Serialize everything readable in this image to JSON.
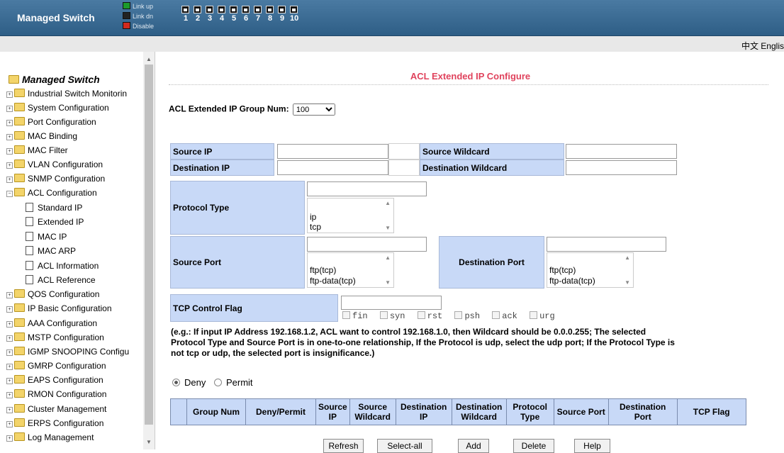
{
  "header": {
    "title": "Managed Switch",
    "legend": [
      {
        "label": "Link up",
        "color": "#1c9a2a"
      },
      {
        "label": "Link dn",
        "color": "#222222"
      },
      {
        "label": "Disable",
        "color": "#d22a1e"
      }
    ],
    "ports": [
      "1",
      "2",
      "3",
      "4",
      "5",
      "6",
      "7",
      "8",
      "9",
      "10"
    ],
    "lang": "中文  Englis"
  },
  "sidebar": {
    "root": "Managed Switch",
    "items": [
      {
        "label": "Industrial Switch Monitorin"
      },
      {
        "label": "System Configuration"
      },
      {
        "label": "Port Configuration"
      },
      {
        "label": "MAC Binding"
      },
      {
        "label": "MAC Filter"
      },
      {
        "label": "VLAN Configuration"
      },
      {
        "label": "SNMP Configuration"
      },
      {
        "label": "ACL Configuration",
        "expanded": true
      },
      {
        "label": "Standard IP",
        "child": true
      },
      {
        "label": "Extended IP",
        "child": true
      },
      {
        "label": "MAC IP",
        "child": true
      },
      {
        "label": "MAC ARP",
        "child": true
      },
      {
        "label": "ACL Information",
        "child": true
      },
      {
        "label": "ACL Reference",
        "child": true
      },
      {
        "label": "QOS Configuration"
      },
      {
        "label": "IP Basic Configuration"
      },
      {
        "label": "AAA Configuration"
      },
      {
        "label": "MSTP Configuration"
      },
      {
        "label": "IGMP SNOOPING Configu"
      },
      {
        "label": "GMRP Configuration"
      },
      {
        "label": "EAPS Configuration"
      },
      {
        "label": "RMON Configuration"
      },
      {
        "label": "Cluster Management"
      },
      {
        "label": "ERPS Configuration"
      },
      {
        "label": "Log Management"
      }
    ]
  },
  "main": {
    "title": "ACL Extended IP Configure",
    "group_label": "ACL Extended IP Group Num:",
    "group_value": "100",
    "source_ip": "Source IP",
    "source_wildcard": "Source Wildcard",
    "destination_ip": "Destination IP",
    "destination_wildcard": "Destination Wildcard",
    "protocol_type": "Protocol Type",
    "protocol_options": [
      "ip",
      "tcp"
    ],
    "source_port": "Source Port",
    "destination_port": "Destination Port",
    "port_options": [
      "ftp(tcp)",
      "ftp-data(tcp)"
    ],
    "tcp_flag": "TCP Control Flag",
    "flags": [
      "fin",
      "syn",
      "rst",
      "psh",
      "ack",
      "urg"
    ],
    "note": "(e.g.: If input IP Address 192.168.1.2, ACL want to control 192.168.1.0, then Wildcard should be 0.0.0.255; The selected Protocol Type and Source Port is in one-to-one relationship, If the Protocol is udp, select the udp port; If the Protocol Type is not tcp or udp, the selected port is insignificance.)",
    "deny": "Deny",
    "permit": "Permit",
    "table_headers": [
      "",
      "Group Num",
      "Deny/Permit",
      "Source IP",
      "Source Wildcard",
      "Destination IP",
      "Destination Wildcard",
      "Protocol Type",
      "Source Port",
      "Destination Port",
      "TCP Flag"
    ],
    "buttons": [
      "Refresh",
      "Select-all",
      "Add",
      "Delete",
      "Help"
    ]
  }
}
